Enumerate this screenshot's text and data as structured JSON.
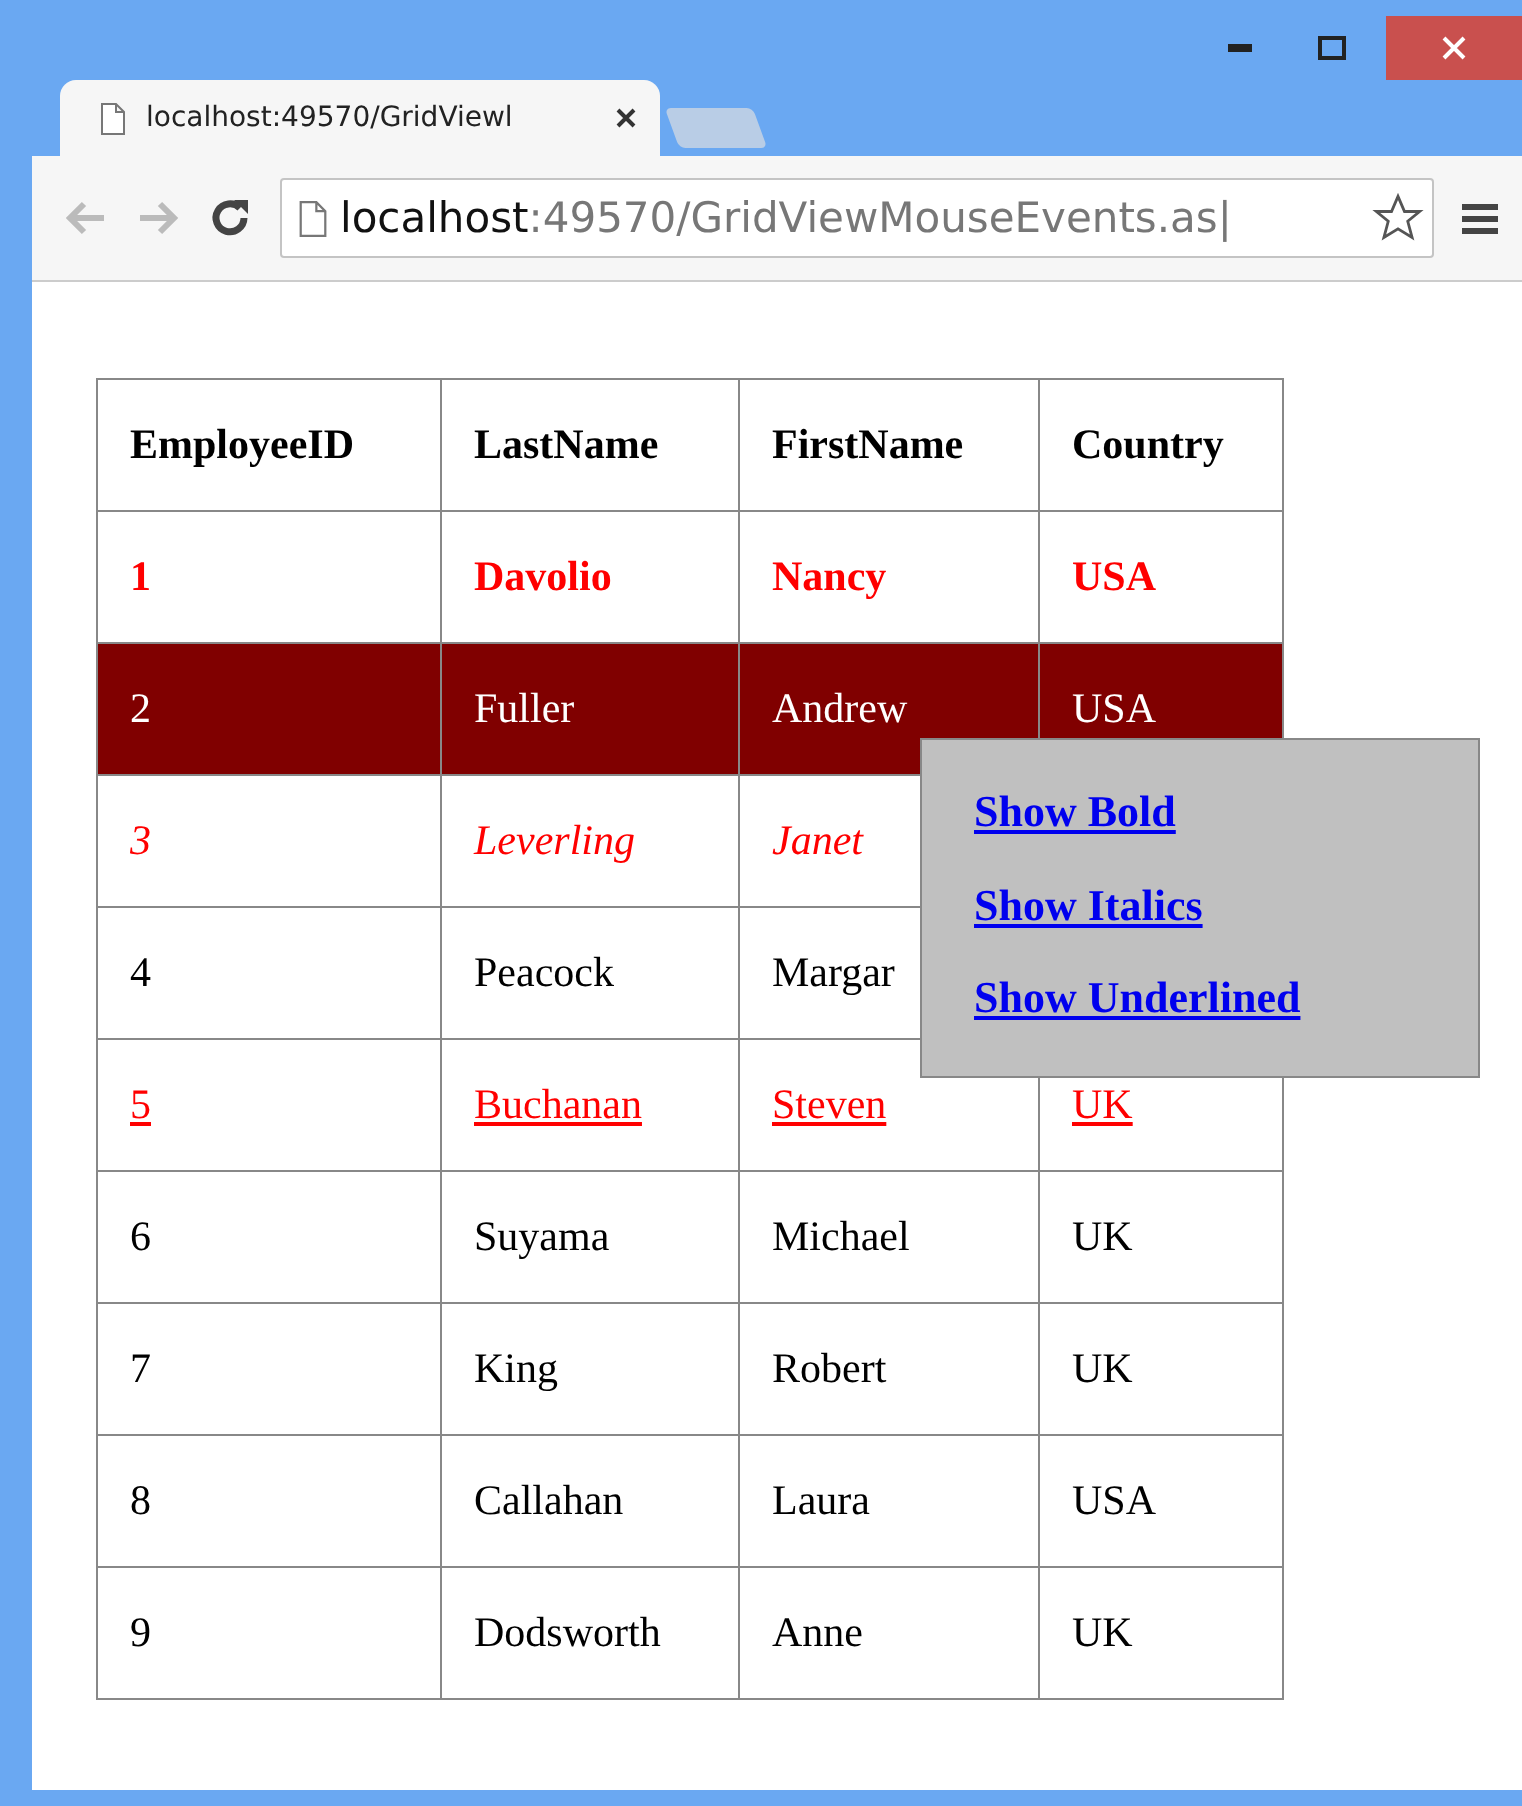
{
  "window": {
    "tab_title": "localhost:49570/GridViewl",
    "address_host": "localhost",
    "address_rest": ":49570/GridViewMouseEvents.as|"
  },
  "table": {
    "columns": [
      "EmployeeID",
      "LastName",
      "FirstName",
      "Country"
    ],
    "rows": [
      {
        "kind": "bold",
        "selected": false,
        "cells": [
          "1",
          "Davolio",
          "Nancy",
          "USA"
        ]
      },
      {
        "kind": "plain",
        "selected": true,
        "cells": [
          "2",
          "Fuller",
          "Andrew",
          "USA"
        ]
      },
      {
        "kind": "italic",
        "selected": false,
        "cells": [
          "3",
          "Leverling",
          "Janet"
        ]
      },
      {
        "kind": "plain",
        "selected": false,
        "cells": [
          "4",
          "Peacock",
          "Margar"
        ]
      },
      {
        "kind": "underline",
        "selected": false,
        "cells": [
          "5",
          "Buchanan",
          "Steven",
          "UK"
        ]
      },
      {
        "kind": "plain",
        "selected": false,
        "cells": [
          "6",
          "Suyama",
          "Michael",
          "UK"
        ]
      },
      {
        "kind": "plain",
        "selected": false,
        "cells": [
          "7",
          "King",
          "Robert",
          "UK"
        ]
      },
      {
        "kind": "plain",
        "selected": false,
        "cells": [
          "8",
          "Callahan",
          "Laura",
          "USA"
        ]
      },
      {
        "kind": "plain",
        "selected": false,
        "cells": [
          "9",
          "Dodsworth",
          "Anne",
          "UK"
        ]
      }
    ]
  },
  "context_menu": {
    "items": [
      "Show Bold",
      "Show Italics",
      "Show Underlined"
    ]
  }
}
